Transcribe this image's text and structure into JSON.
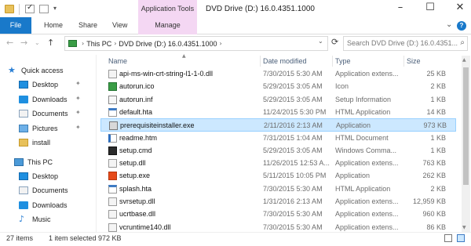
{
  "window": {
    "title": "DVD Drive (D:) 16.0.4351.1000",
    "contextual_tab_group": "Application Tools"
  },
  "ribbon": {
    "file_tab": "File",
    "tabs": [
      "Home",
      "Share",
      "View"
    ],
    "manage_tab": "Manage"
  },
  "address": {
    "crumbs": [
      "This PC",
      "DVD Drive (D:) 16.0.4351.1000"
    ],
    "search_placeholder": "Search DVD Drive (D:) 16.0.4351..."
  },
  "nav": {
    "items": [
      {
        "label": "Quick access",
        "icon": "star-icon",
        "pinned": false
      },
      {
        "label": "Desktop",
        "icon": "desktop-icon",
        "pinned": true
      },
      {
        "label": "Downloads",
        "icon": "downloads-icon",
        "pinned": true
      },
      {
        "label": "Documents",
        "icon": "documents-icon",
        "pinned": true
      },
      {
        "label": "Pictures",
        "icon": "pictures-icon",
        "pinned": true
      },
      {
        "label": "install",
        "icon": "folder-icon",
        "pinned": false
      },
      {
        "label": "This PC",
        "icon": "computer-icon",
        "pinned": false
      },
      {
        "label": "Desktop",
        "icon": "desktop-icon",
        "pinned": false
      },
      {
        "label": "Documents",
        "icon": "documents-icon",
        "pinned": false
      },
      {
        "label": "Downloads",
        "icon": "downloads-icon",
        "pinned": false
      },
      {
        "label": "Music",
        "icon": "music-icon",
        "pinned": false
      }
    ]
  },
  "columns": {
    "name": "Name",
    "date": "Date modified",
    "type": "Type",
    "size": "Size"
  },
  "files": [
    {
      "name": "api-ms-win-crt-string-l1-1-0.dll",
      "date": "7/30/2015 5:30 AM",
      "type": "Application extens...",
      "size": "25 KB",
      "icon": "dll"
    },
    {
      "name": "autorun.ico",
      "date": "5/29/2015 3:05 AM",
      "type": "Icon",
      "size": "2 KB",
      "icon": "ico"
    },
    {
      "name": "autorun.inf",
      "date": "5/29/2015 3:05 AM",
      "type": "Setup Information",
      "size": "1 KB",
      "icon": "inf"
    },
    {
      "name": "default.hta",
      "date": "11/24/2015 5:30 PM",
      "type": "HTML Application",
      "size": "14 KB",
      "icon": "hta"
    },
    {
      "name": "prerequisiteinstaller.exe",
      "date": "2/11/2016 2:13 AM",
      "type": "Application",
      "size": "973 KB",
      "icon": "exe"
    },
    {
      "name": "readme.htm",
      "date": "7/31/2015 1:04 AM",
      "type": "HTML Document",
      "size": "1 KB",
      "icon": "htm"
    },
    {
      "name": "setup.cmd",
      "date": "5/29/2015 3:05 AM",
      "type": "Windows Comma...",
      "size": "1 KB",
      "icon": "cmd"
    },
    {
      "name": "setup.dll",
      "date": "11/26/2015 12:53 A...",
      "type": "Application extens...",
      "size": "763 KB",
      "icon": "dll"
    },
    {
      "name": "setup.exe",
      "date": "5/11/2015 10:05 PM",
      "type": "Application",
      "size": "262 KB",
      "icon": "office"
    },
    {
      "name": "splash.hta",
      "date": "7/30/2015 5:30 AM",
      "type": "HTML Application",
      "size": "2 KB",
      "icon": "hta"
    },
    {
      "name": "svrsetup.dll",
      "date": "1/31/2016 2:13 AM",
      "type": "Application extens...",
      "size": "12,959 KB",
      "icon": "dll"
    },
    {
      "name": "ucrtbase.dll",
      "date": "7/30/2015 5:30 AM",
      "type": "Application extens...",
      "size": "960 KB",
      "icon": "dll"
    },
    {
      "name": "vcruntime140.dll",
      "date": "7/30/2015 5:30 AM",
      "type": "Application extens...",
      "size": "86 KB",
      "icon": "dll"
    }
  ],
  "selected_index": 4,
  "status": {
    "count": "27 items",
    "selection": "1 item selected  972 KB"
  },
  "colors": {
    "file_tab": "#1979ca",
    "contextual_tab": "#f4d7f3",
    "selection": "#cce8ff"
  }
}
